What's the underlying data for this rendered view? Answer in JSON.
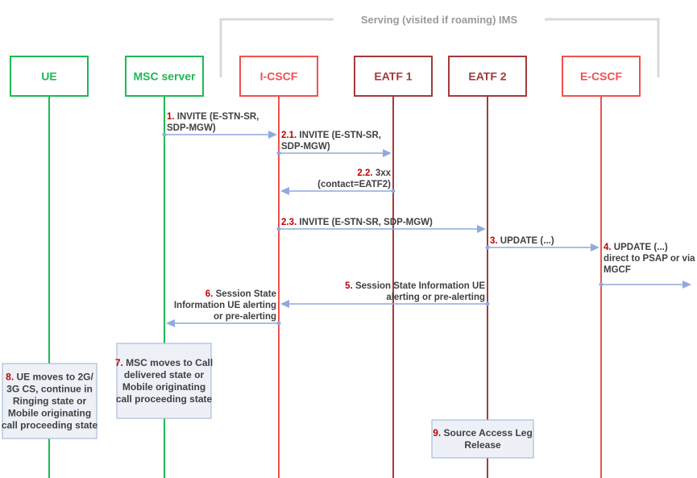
{
  "group": {
    "label": "Serving (visited if roaming) IMS",
    "color": "#d9d9d9"
  },
  "colors": {
    "green": "#1db954",
    "red": "#f05050",
    "darkred": "#a33a3a",
    "arrow": "#8faadc",
    "note_fill": "#edf1f7",
    "note_stroke": "#a9bcd9",
    "step_number": "#c00000",
    "text": "#404040"
  },
  "entities": [
    {
      "id": "ue",
      "label": "UE",
      "color": "green"
    },
    {
      "id": "msc",
      "label": "MSC server",
      "color": "green"
    },
    {
      "id": "icscf",
      "label": "I-CSCF",
      "color": "red"
    },
    {
      "id": "eatf1",
      "label": "EATF 1",
      "color": "darkred"
    },
    {
      "id": "eatf2",
      "label": "EATF 2",
      "color": "darkred"
    },
    {
      "id": "ecscf",
      "label": "E-CSCF",
      "color": "red"
    }
  ],
  "messages": [
    {
      "num": "1.",
      "from": "msc",
      "to": "icscf",
      "lines": [
        "INVITE (E-STN-SR,",
        "SDP-MGW)"
      ],
      "align": "left"
    },
    {
      "num": "2.1.",
      "from": "icscf",
      "to": "eatf1",
      "lines": [
        "INVITE (E-STN-SR,",
        "SDP-MGW)"
      ],
      "align": "left"
    },
    {
      "num": "2.2.",
      "from": "eatf1",
      "to": "icscf",
      "lines": [
        "3xx",
        "(contact=EATF2)"
      ],
      "align": "right"
    },
    {
      "num": "2.3.",
      "from": "icscf",
      "to": "eatf2",
      "lines": [
        "INVITE (E-STN-SR, SDP-MGW)"
      ],
      "align": "left"
    },
    {
      "num": "3.",
      "from": "eatf2",
      "to": "ecscf",
      "lines": [
        "UPDATE (...)"
      ],
      "align": "left"
    },
    {
      "num": "4.",
      "from": "ecscf",
      "to": "out",
      "lines": [
        "UPDATE  (...)",
        "direct to PSAP or via",
        "MGCF"
      ],
      "align": "left"
    },
    {
      "num": "5.",
      "from": "eatf2",
      "to": "icscf",
      "lines": [
        "Session State Information UE",
        "alerting or pre-alerting"
      ],
      "align": "right"
    },
    {
      "num": "6.",
      "from": "icscf",
      "to": "msc",
      "lines": [
        "Session State",
        "Information UE alerting",
        "or pre-alerting"
      ],
      "align": "right"
    }
  ],
  "notes": [
    {
      "num": "8.",
      "on": "ue",
      "lines": [
        "UE moves to 2G/",
        "3G CS, continue in",
        "Ringing state or",
        "Mobile originating",
        "call proceeding state"
      ]
    },
    {
      "num": "7.",
      "on": "msc",
      "lines": [
        "MSC moves to Call",
        "delivered state or",
        "Mobile originating",
        "call proceeding state"
      ]
    },
    {
      "num": "9.",
      "on": "eatf2",
      "lines": [
        "Source Access Leg",
        "Release"
      ]
    }
  ]
}
